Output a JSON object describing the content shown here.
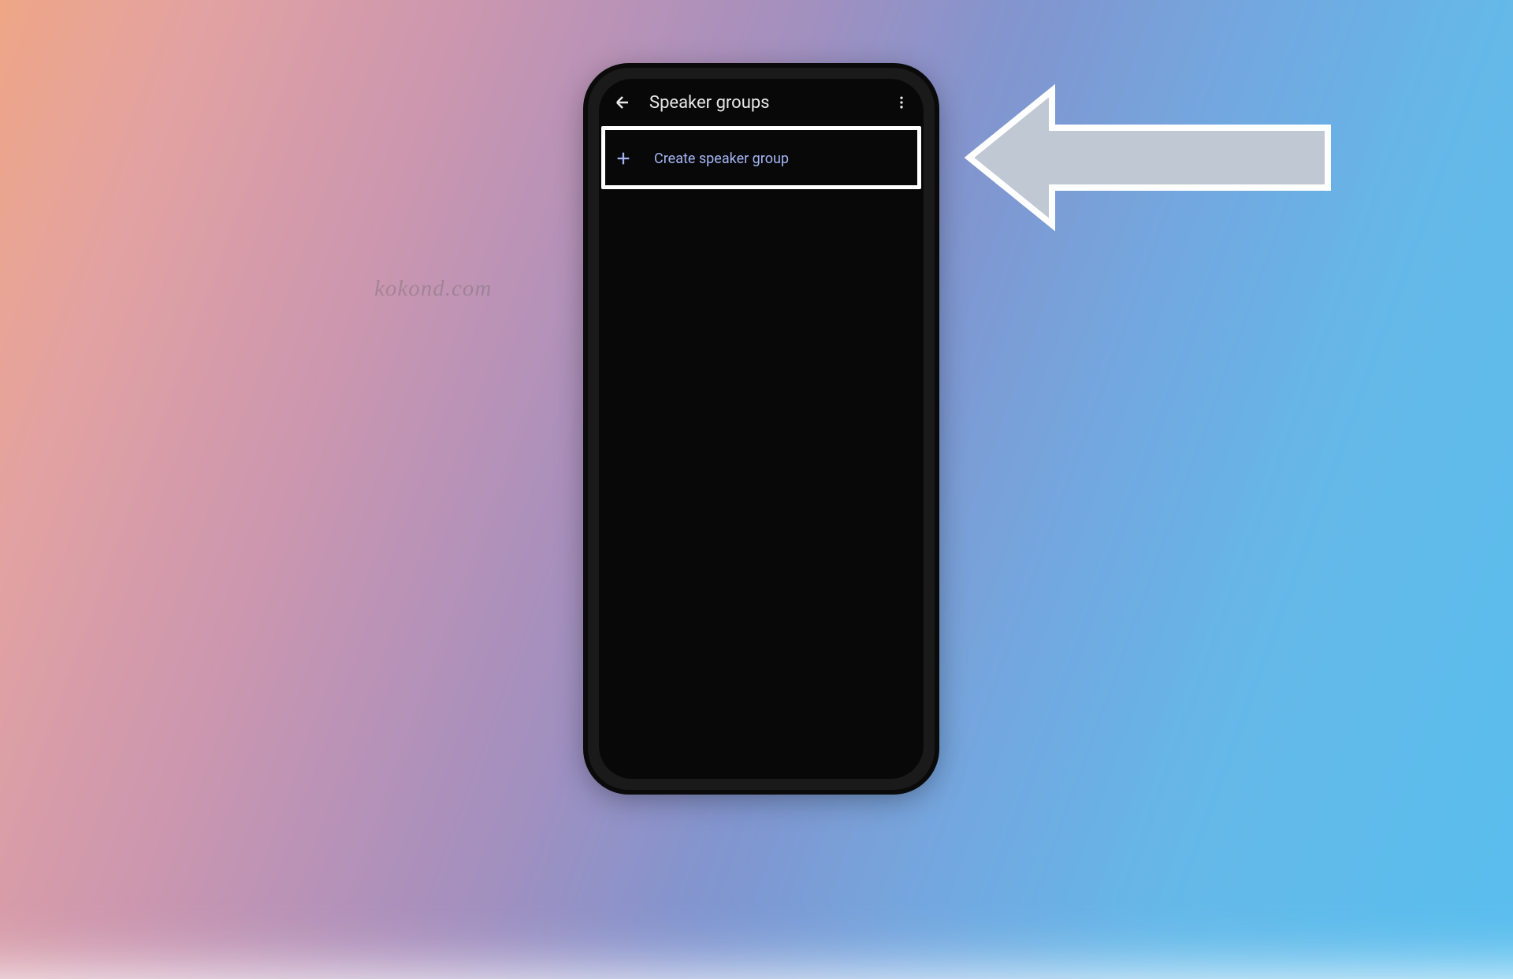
{
  "watermark": "kokond.com",
  "app_bar": {
    "title": "Speaker groups"
  },
  "list": {
    "create_label": "Create speaker group"
  },
  "colors": {
    "accent": "#a4b5f5",
    "text": "#e8e8e8",
    "screen_bg": "#080808"
  }
}
